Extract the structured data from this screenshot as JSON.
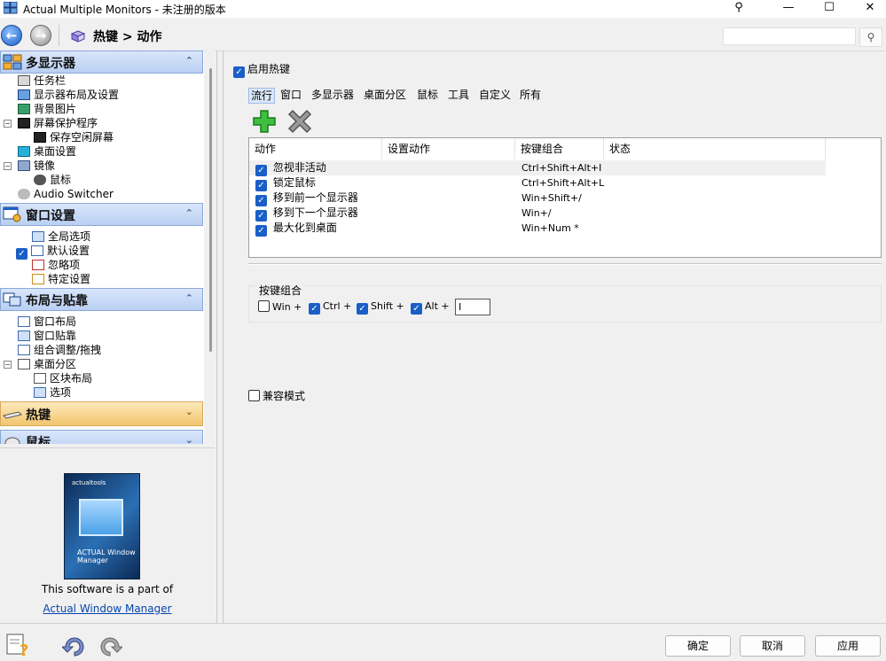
{
  "window": {
    "title": "Actual Multiple Monitors - 未注册的版本",
    "controls": {
      "pin": "⚲",
      "minimize": "—",
      "maximize": "☐",
      "close": "✕"
    }
  },
  "toolbar": {
    "back_icon": "back-arrow-icon",
    "forward_icon": "forward-arrow-icon",
    "breadcrumb": "热键 > 动作",
    "search_placeholder": "",
    "search_icon": "magnifier-icon"
  },
  "sidebar": {
    "groups": [
      {
        "title": "多显示器",
        "icon": "monitors-icon",
        "items": [
          {
            "label": "任务栏"
          },
          {
            "label": "显示器布局及设置"
          },
          {
            "label": "背景图片"
          },
          {
            "label": "屏幕保护程序"
          },
          {
            "label": "保存空闲屏幕"
          },
          {
            "label": "桌面设置"
          },
          {
            "label": "镜像"
          },
          {
            "label": "鼠标"
          },
          {
            "label": "Audio Switcher"
          }
        ]
      },
      {
        "title": "窗口设置",
        "icon": "window-settings-icon",
        "items": [
          {
            "label": "全局选项"
          },
          {
            "label": "默认设置"
          },
          {
            "label": "忽略项"
          },
          {
            "label": "特定设置"
          }
        ]
      },
      {
        "title": "布局与贴靠",
        "icon": "layout-snap-icon",
        "items": [
          {
            "label": "窗口布局"
          },
          {
            "label": "窗口贴靠"
          },
          {
            "label": "组合调整/拖拽"
          },
          {
            "label": "桌面分区"
          },
          {
            "label": "区块布局"
          },
          {
            "label": "选项"
          }
        ]
      },
      {
        "title": "热键",
        "icon": "keyboard-icon"
      },
      {
        "title": "鼠标",
        "icon": "mouse-icon"
      }
    ],
    "chevron_up": "⌃",
    "chevron_down": "⌄"
  },
  "promo": {
    "product_brand": "actualtools",
    "product_box_title": "ACTUAL Window Manager",
    "text": "This software is a part of",
    "link": "Actual Window Manager"
  },
  "main": {
    "enable_hotkeys": {
      "label": "启用热键",
      "checked": true
    },
    "tabs": [
      "流行",
      "窗口",
      "多显示器",
      "桌面分区",
      "鼠标",
      "工具",
      "自定义",
      "所有"
    ],
    "active_tab": "流行",
    "add_icon": "add-plus-icon",
    "delete_icon": "delete-x-icon",
    "table": {
      "columns": [
        "动作",
        "设置动作",
        "按键组合",
        "状态"
      ],
      "rows": [
        {
          "action": "忽视非活动",
          "setting": "",
          "keys": "Ctrl+Shift+Alt+I",
          "status": "",
          "checked": true
        },
        {
          "action": "锁定鼠标",
          "setting": "",
          "keys": "Ctrl+Shift+Alt+L",
          "status": "",
          "checked": true
        },
        {
          "action": "移到前一个显示器",
          "setting": "",
          "keys": "Win+Shift+/",
          "status": "",
          "checked": true
        },
        {
          "action": "移到下一个显示器",
          "setting": "",
          "keys": "Win+/",
          "status": "",
          "checked": true
        },
        {
          "action": "最大化到桌面",
          "setting": "",
          "keys": "Win+Num *",
          "status": "",
          "checked": true
        }
      ]
    },
    "hotkey_group": {
      "label": "按键组合",
      "modifiers": [
        {
          "label": "Win +",
          "checked": false
        },
        {
          "label": "Ctrl +",
          "checked": true
        },
        {
          "label": "Shift +",
          "checked": true
        },
        {
          "label": "Alt +",
          "checked": true
        }
      ],
      "key_value": "I"
    },
    "compat_mode": {
      "label": "兼容模式",
      "checked": false
    }
  },
  "bottom": {
    "help_icon": "help-question-icon",
    "undo_icon": "undo-arrow-icon",
    "redo_icon": "redo-arrow-icon",
    "ok": "确定",
    "cancel": "取消",
    "apply": "应用"
  }
}
